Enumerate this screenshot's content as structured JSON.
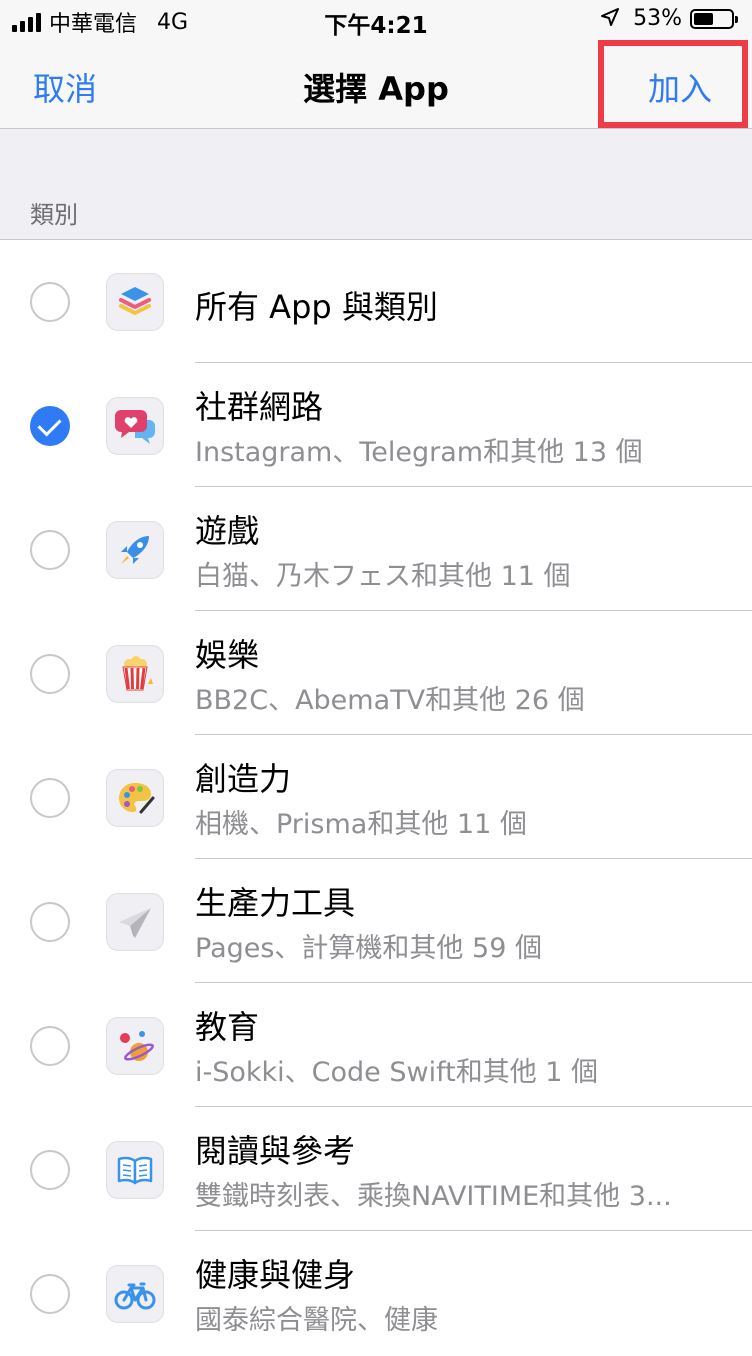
{
  "status_bar": {
    "carrier": "中華電信",
    "network": "4G",
    "time": "下午4:21",
    "battery_percent_label": "53%",
    "battery_level": 0.53
  },
  "nav": {
    "cancel_label": "取消",
    "title": "選擇 App",
    "add_label": "加入",
    "highlight_color": "#ee3b48"
  },
  "section": {
    "label": "類別"
  },
  "categories": [
    {
      "title": "所有 App 與類別",
      "subtitle": "",
      "checked": false,
      "icon": "layers-stack-icon"
    },
    {
      "title": "社群網路",
      "subtitle": "Instagram、Telegram和其他 13 個",
      "checked": true,
      "icon": "chat-heart-icon"
    },
    {
      "title": "遊戲",
      "subtitle": "白猫、乃木フェス和其他 11 個",
      "checked": false,
      "icon": "rocket-icon"
    },
    {
      "title": "娛樂",
      "subtitle": "BB2C、AbemaTV和其他 26 個",
      "checked": false,
      "icon": "popcorn-icon"
    },
    {
      "title": "創造力",
      "subtitle": "相機、Prisma和其他 11 個",
      "checked": false,
      "icon": "palette-icon"
    },
    {
      "title": "生產力工具",
      "subtitle": "Pages、計算機和其他 59 個",
      "checked": false,
      "icon": "paper-plane-icon"
    },
    {
      "title": "教育",
      "subtitle": "i-Sokki、Code Swift和其他 1 個",
      "checked": false,
      "icon": "planet-icon"
    },
    {
      "title": "閱讀與參考",
      "subtitle": "雙鐵時刻表、乘換NAVITIME和其他 3...",
      "checked": false,
      "icon": "open-book-icon"
    },
    {
      "title": "健康與健身",
      "subtitle": "國泰綜合醫院、健康",
      "checked": false,
      "icon": "bicycle-icon"
    }
  ],
  "colors": {
    "accent": "#2f7bf5",
    "separator": "#c8c7cc",
    "group_background": "#efeff4"
  }
}
